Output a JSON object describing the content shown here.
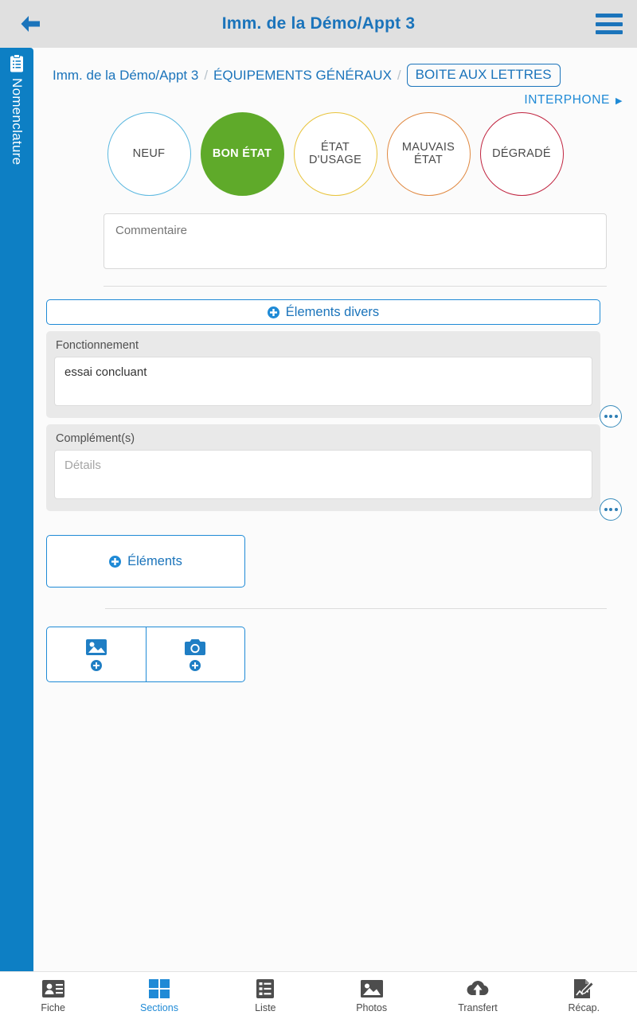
{
  "colors": {
    "brand_blue": "#1b74bb",
    "accent_blue": "#1f8ad6",
    "sidebar_blue": "#0d7fc4",
    "topbar_bg": "#e0e0e0",
    "green": "#5faa2a",
    "yellow": "#e8c33a",
    "orange": "#e08840",
    "red": "#c0233f",
    "light_blue": "#5bb8e0",
    "group_bg": "#e9e9e9"
  },
  "topbar": {
    "back_icon": "arrow-left-icon",
    "title": "Imm. de la Démo/Appt 3",
    "menu_icon": "hamburger-menu-icon"
  },
  "sidebar": {
    "icon": "clipboard-icon",
    "label": "Nomenclature"
  },
  "breadcrumb": {
    "items": [
      {
        "label": "Imm. de la Démo/Appt 3",
        "current": false
      },
      {
        "label": "ÉQUIPEMENTS GÉNÉRAUX",
        "current": false
      },
      {
        "label": "BOITE AUX LETTRES",
        "current": true
      }
    ],
    "separator": "/"
  },
  "next_link": {
    "label": "INTERPHONE",
    "arrow": "▶",
    "icon": "chevron-right-icon"
  },
  "conditions": [
    {
      "label": "NEUF",
      "color": "#5bb8e0",
      "selected": false
    },
    {
      "label": "BON ÉTAT",
      "color": "#5faa2a",
      "selected": true
    },
    {
      "label": "ÉTAT D'USAGE",
      "color": "#e8c33a",
      "selected": false
    },
    {
      "label": "MAUVAIS ÉTAT",
      "color": "#e08840",
      "selected": false
    },
    {
      "label": "DÉGRADÉ",
      "color": "#c0233f",
      "selected": false
    }
  ],
  "comment": {
    "placeholder": "Commentaire",
    "value": ""
  },
  "buttons": {
    "elements_divers": "Élements divers",
    "elements": "Éléments",
    "plus_icon": "plus-circle-icon"
  },
  "fields": [
    {
      "label": "Fonctionnement",
      "value": "essai concluant",
      "placeholder": "",
      "more_icon": "more-options-icon"
    },
    {
      "label": "Complément(s)",
      "value": "",
      "placeholder": "Détails",
      "more_icon": "more-options-icon"
    }
  ],
  "media": [
    {
      "name": "gallery",
      "icon": "image-add-icon",
      "badge_icon": "plus-circle-icon"
    },
    {
      "name": "camera",
      "icon": "camera-add-icon",
      "badge_icon": "plus-circle-icon"
    }
  ],
  "bottom_nav": [
    {
      "label": "Fiche",
      "icon": "contact-card-icon",
      "active": false
    },
    {
      "label": "Sections",
      "icon": "grid-squares-icon",
      "active": true
    },
    {
      "label": "Liste",
      "icon": "list-icon",
      "active": false
    },
    {
      "label": "Photos",
      "icon": "photo-icon",
      "active": false
    },
    {
      "label": "Transfert",
      "icon": "cloud-upload-icon",
      "active": false
    },
    {
      "label": "Récap.",
      "icon": "document-edit-icon",
      "active": false
    }
  ]
}
